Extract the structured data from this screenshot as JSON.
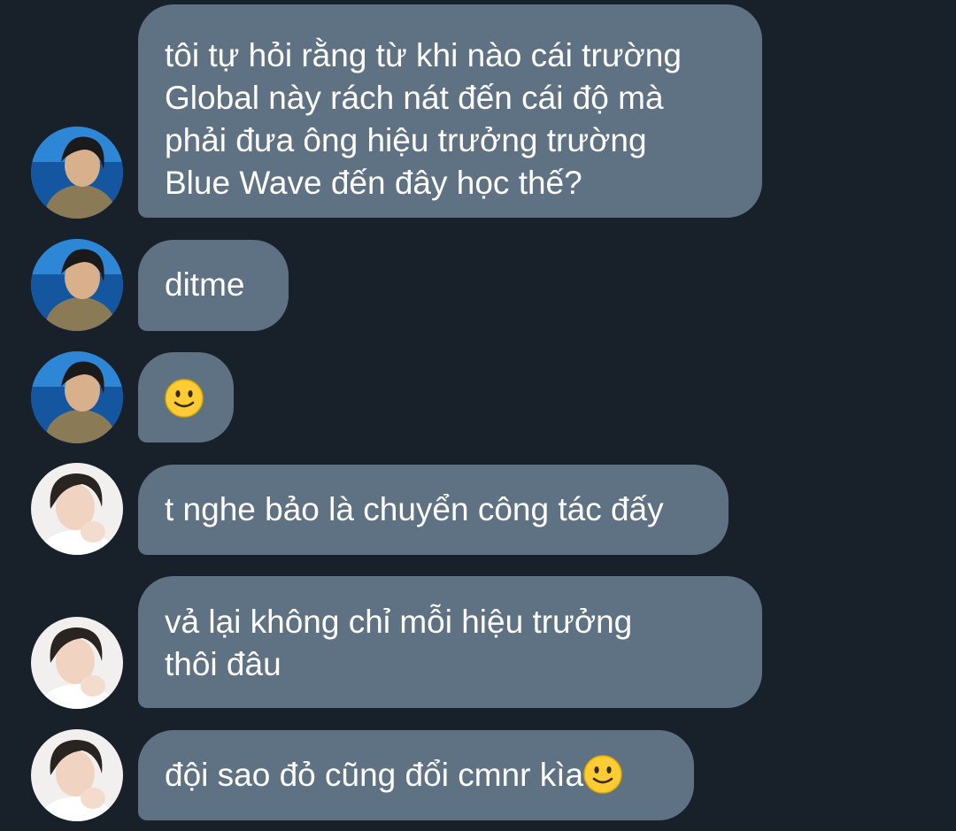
{
  "messages": [
    {
      "sender": "avatar-sea",
      "text": "tôi tự hỏi rằng từ khi nào cái trường\nGlobal này rách nát đến cái độ mà\nphải đưa ông hiệu trưởng trường\nBlue Wave đến đây học thế?",
      "emoji": ""
    },
    {
      "sender": "avatar-sea",
      "text": "ditme",
      "emoji": ""
    },
    {
      "sender": "avatar-sea",
      "text": "",
      "emoji": "slightly-smiling-face"
    },
    {
      "sender": "avatar-white",
      "text": "t nghe bảo là chuyển công tác đấy",
      "emoji": ""
    },
    {
      "sender": "avatar-white",
      "text": "vả lại không chỉ mỗi hiệu trưởng\nthôi đâu",
      "emoji": ""
    },
    {
      "sender": "avatar-white",
      "text": "đội sao đỏ cũng đổi cmnr kìa",
      "emoji": "slightly-smiling-face"
    }
  ],
  "colors": {
    "background": "#18202a",
    "bubble": "#5f7283",
    "text": "#ffffff"
  }
}
